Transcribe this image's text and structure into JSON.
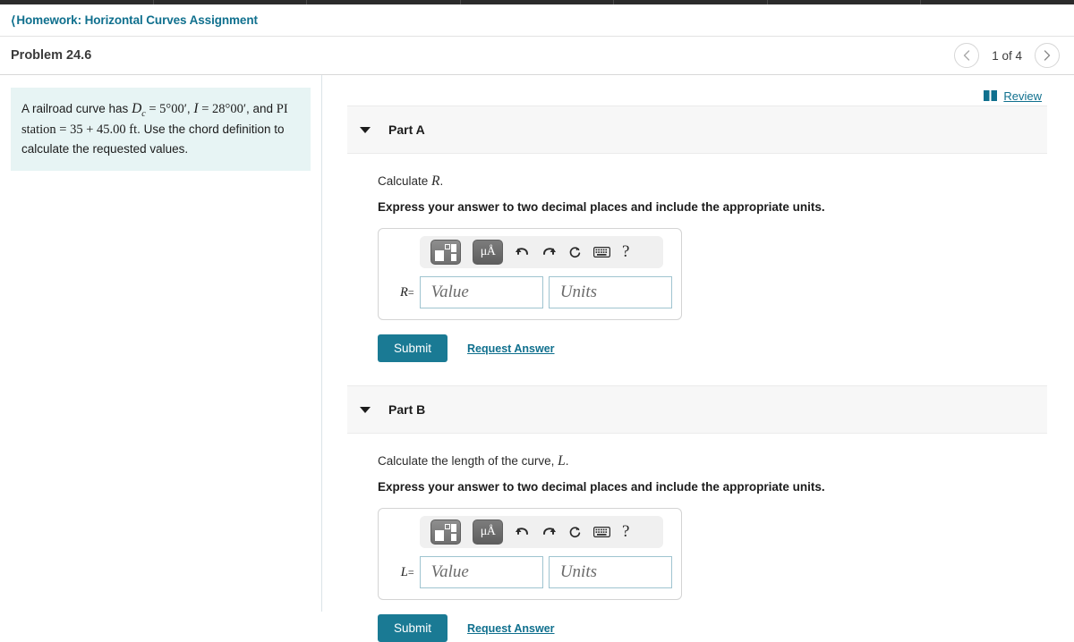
{
  "breadcrumb": {
    "back_icon": "chevron-left-icon",
    "label": "Homework: Horizontal Curves Assignment"
  },
  "header": {
    "problem_title": "Problem 24.6",
    "pager": {
      "prev_icon": "chevron-left-icon",
      "next_icon": "chevron-right-icon",
      "count_label": "1 of 4"
    }
  },
  "problem": {
    "text_plain": "A railroad curve has Dc = 5°00′, I = 28°00′, and PI station = 35 + 45.00 ft. Use the chord definition to calculate the requested values.",
    "segments": {
      "lead": "A railroad curve has ",
      "dc_var": "D",
      "dc_sub": "c",
      "dc_eq": " = ",
      "dc_val": "5°00′",
      "comma1": ", ",
      "i_var": "I",
      "i_eq": " = ",
      "i_val": "28°00′",
      "and": ", and ",
      "pi_label": "PI station",
      "pi_eq": " = ",
      "pi_val": "35 + 45.00 ft",
      "tail": ". Use the chord definition to calculate the requested values."
    }
  },
  "review": {
    "icon": "book-icon",
    "label": "Review"
  },
  "parts": [
    {
      "caret_icon": "caret-down-icon",
      "label": "Part A",
      "question_lead": "Calculate ",
      "question_var": "R",
      "question_tail": ".",
      "instruction": "Express your answer to two decimal places and include the appropriate units.",
      "answer": {
        "var_label": "R",
        "equals": "=",
        "value_placeholder": "Value",
        "units_placeholder": "Units",
        "value_text": "",
        "units_text": ""
      },
      "toolbar": {
        "template_icon": "math-template-icon",
        "unit_icon_label": "μÅ",
        "undo_icon": "undo-icon",
        "redo_icon": "redo-icon",
        "reset_icon": "reset-icon",
        "keyboard_icon": "keyboard-icon",
        "help_icon": "?"
      },
      "submit_label": "Submit",
      "request_label": "Request Answer"
    },
    {
      "caret_icon": "caret-down-icon",
      "label": "Part B",
      "question_lead": "Calculate the length of the curve, ",
      "question_var": "L",
      "question_tail": ".",
      "instruction": "Express your answer to two decimal places and include the appropriate units.",
      "answer": {
        "var_label": "L",
        "equals": "=",
        "value_placeholder": "Value",
        "units_placeholder": "Units",
        "value_text": "",
        "units_text": ""
      },
      "toolbar": {
        "template_icon": "math-template-icon",
        "unit_icon_label": "μÅ",
        "undo_icon": "undo-icon",
        "redo_icon": "redo-icon",
        "reset_icon": "reset-icon",
        "keyboard_icon": "keyboard-icon",
        "help_icon": "?"
      },
      "submit_label": "Submit",
      "request_label": "Request Answer"
    }
  ],
  "colors": {
    "accent_teal": "#1a7a94",
    "link_teal": "#10708e",
    "problem_bg": "#e7f4f4",
    "part_header_bg": "#f7f7f7",
    "field_border": "#9fc4d0"
  }
}
